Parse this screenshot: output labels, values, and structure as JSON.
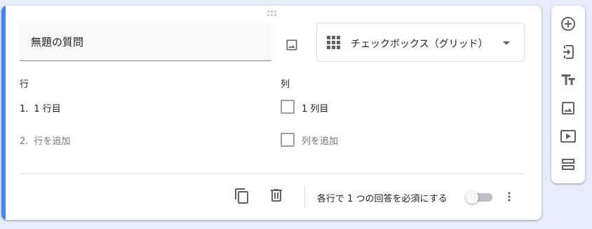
{
  "question": {
    "title": "無題の質問",
    "type_label": "チェックボックス（グリッド）",
    "type_icon": "grid-icon"
  },
  "rows": {
    "header": "行",
    "items": [
      {
        "num": "1.",
        "label": "1 行目"
      },
      {
        "num": "2.",
        "label": "行を追加"
      }
    ]
  },
  "columns": {
    "header": "列",
    "items": [
      {
        "label": "1 列目"
      },
      {
        "label": "列を追加"
      }
    ]
  },
  "footer": {
    "required_label": "各行で 1 つの回答を必須にする",
    "toggle_on": false,
    "icons": [
      "copy-icon",
      "trash-icon",
      "more-vert-icon"
    ]
  },
  "sidebar": {
    "tools": [
      "add-circle-icon",
      "import-icon",
      "title-text-icon",
      "image-icon",
      "video-icon",
      "section-icon"
    ]
  },
  "colors": {
    "accent": "#4285f4",
    "background": "#e8edfb",
    "icon": "#5f6368"
  }
}
